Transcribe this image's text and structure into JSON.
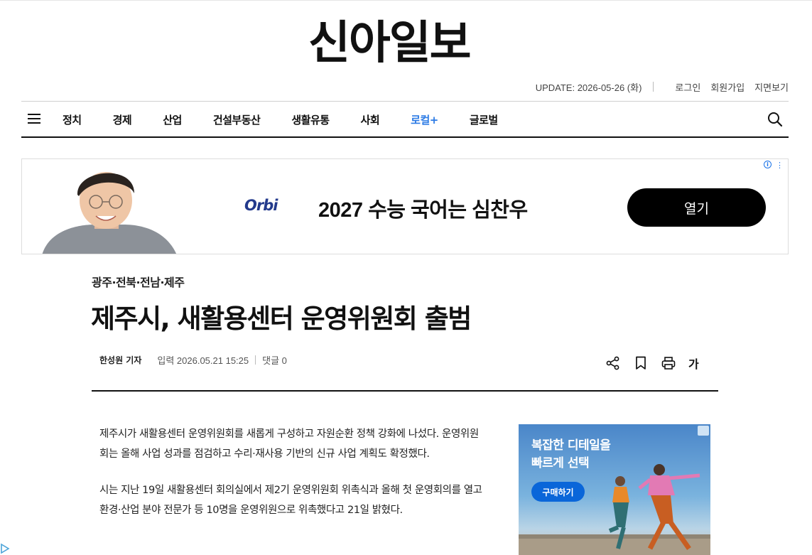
{
  "masthead": {
    "logo": "신아일보"
  },
  "utility": {
    "update": "UPDATE: 2026-05-26 (화)",
    "links": [
      "로그인",
      "회원가입",
      "지면보기"
    ]
  },
  "nav": {
    "items": [
      "정치",
      "경제",
      "산업",
      "건설부동산",
      "생활유통",
      "사회",
      "로컬+",
      "글로벌"
    ]
  },
  "ad_banner": {
    "brand": "Orbi",
    "headline": "2027 수능 국어는 심찬우",
    "cta": "열기"
  },
  "article": {
    "section": "광주·전북·전남·제주",
    "headline": "제주시, 새활용센터 운영위원회 출범",
    "author": "한성원 기자",
    "date": "입력 2026.05.21 15:25",
    "comments": "댓글 0",
    "font_tool": "가",
    "paragraphs": [
      "제주시가 새활용센터 운영위원회를 새롭게 구성하고 자원순환 정책 강화에 나섰다. 운영위원회는 올해 사업 성과를 점검하고 수리·재사용 기반의 신규 사업 계획도 확정했다.",
      "시는 지난 19일 새활용센터 회의실에서 제2기 운영위원회 위촉식과 올해 첫 운영회의를 열고 환경·산업 분야 전문가 등 10명을 운영위원으로 위촉했다고 21일 밝혔다."
    ]
  },
  "side_ad": {
    "title_lines": [
      "복잡한 디테일을",
      "빠르게 선택"
    ],
    "cta": "구매하기"
  }
}
